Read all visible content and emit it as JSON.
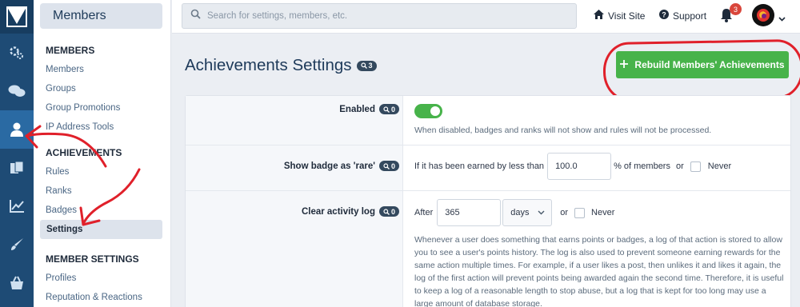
{
  "brand": {
    "logo_icon": "xenforo-logo-icon"
  },
  "rail": {
    "items": [
      {
        "name": "setup-icon",
        "active": false
      },
      {
        "name": "forums-icon",
        "active": false
      },
      {
        "name": "users-icon",
        "active": true
      },
      {
        "name": "content-icon",
        "active": false
      },
      {
        "name": "stats-icon",
        "active": false
      },
      {
        "name": "appearance-icon",
        "active": false
      },
      {
        "name": "shop-icon",
        "active": false
      }
    ]
  },
  "sidebar": {
    "header": "Members",
    "groups": [
      {
        "title": "MEMBERS",
        "items": [
          "Members",
          "Groups",
          "Group Promotions",
          "IP Address Tools"
        ]
      },
      {
        "title": "ACHIEVEMENTS",
        "items": [
          "Rules",
          "Ranks",
          "Badges",
          "Settings"
        ]
      },
      {
        "title": "MEMBER SETTINGS",
        "items": [
          "Profiles",
          "Reputation & Reactions"
        ]
      }
    ],
    "active_item": "Settings"
  },
  "topbar": {
    "search_placeholder": "Search for settings, members, etc.",
    "visit_site": "Visit Site",
    "support": "Support",
    "notification_count": "3"
  },
  "page": {
    "title": "Achievements Settings",
    "title_badge": "3",
    "rebuild_button": "Rebuild Members' Achievements"
  },
  "settings": {
    "enabled": {
      "label": "Enabled",
      "badge": "0",
      "on": true,
      "hint": "When disabled, badges and ranks will not show and rules will not be processed."
    },
    "rare": {
      "label": "Show badge as 'rare'",
      "badge": "0",
      "prefix": "If it has been earned by less than",
      "value": "100.0",
      "suffix": "% of members",
      "or": "or",
      "never": "Never"
    },
    "clear_log": {
      "label": "Clear activity log",
      "badge": "0",
      "after": "After",
      "value": "365",
      "unit": "days",
      "or": "or",
      "never": "Never",
      "hint": "Whenever a user does something that earns points or badges, a log of that action is stored to allow you to see a user's points history. The log is also used to prevent someone earning rewards for the same action multiple times. For example, if a user likes a post, then unlikes it and likes it again, the log of the first action will prevent points being awarded again the second time. Therefore, it is useful to keep a log of a reasonable length to stop abuse, but a log that is kept for too long may use a large amount of database storage."
    }
  },
  "colors": {
    "rail": "#1e4b75",
    "accent_green": "#47b34a",
    "annotation_red": "#e0202a",
    "badge_dark": "#34495e"
  }
}
